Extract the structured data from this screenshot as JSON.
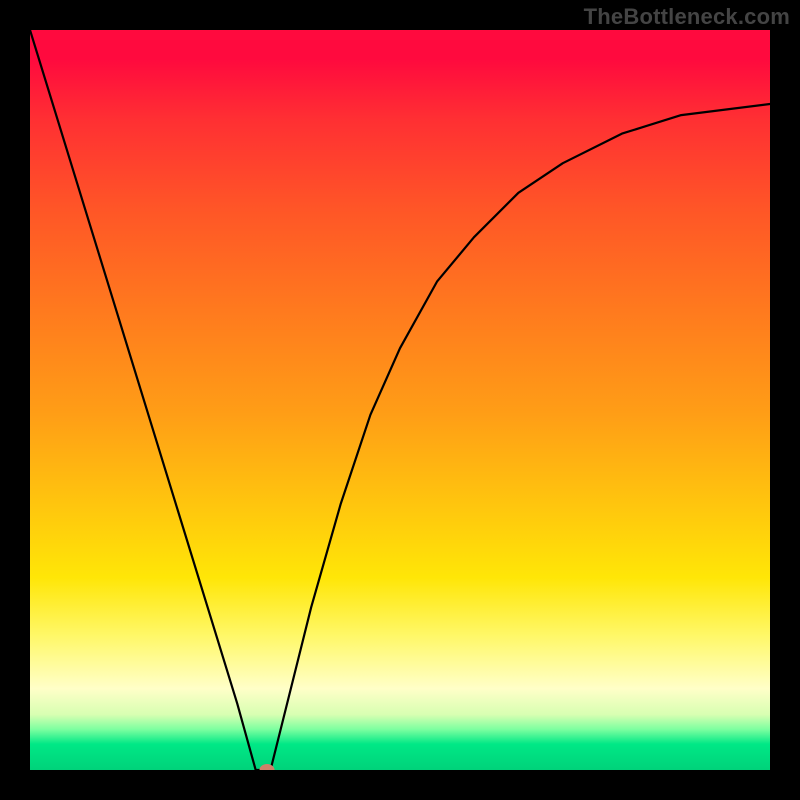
{
  "watermark": "TheBottleneck.com",
  "colors": {
    "frame": "#000000",
    "curve": "#000000",
    "marker": "#cf8169",
    "gradient_stops": [
      "#ff0a3e",
      "#ff2f33",
      "#ff5527",
      "#ff7a1e",
      "#ff9e16",
      "#ffc50e",
      "#ffe607",
      "#fff86a",
      "#ffffc8",
      "#d8ffb2",
      "#7dffa0",
      "#00e886",
      "#00d27a"
    ]
  },
  "chart_data": {
    "type": "line",
    "title": "",
    "xlabel": "",
    "ylabel": "",
    "xlim": [
      0,
      100
    ],
    "ylim": [
      0,
      100
    ],
    "series": [
      {
        "name": "bottleneck-curve-left",
        "x": [
          0,
          4,
          8,
          12,
          16,
          20,
          24,
          28,
          30.5
        ],
        "values": [
          100,
          87,
          74,
          61,
          48,
          35,
          22,
          9,
          0
        ]
      },
      {
        "name": "bottleneck-curve-min-flat",
        "x": [
          30.5,
          32.5
        ],
        "values": [
          0,
          0
        ]
      },
      {
        "name": "bottleneck-curve-right",
        "x": [
          32.5,
          35,
          38,
          42,
          46,
          50,
          55,
          60,
          66,
          72,
          80,
          88,
          100
        ],
        "values": [
          0,
          10,
          22,
          36,
          48,
          57,
          66,
          72,
          78,
          82,
          86,
          88.5,
          90
        ]
      }
    ],
    "annotations": [
      {
        "name": "min-marker",
        "x": 32,
        "y": 0
      }
    ],
    "legend": false,
    "grid": false
  }
}
